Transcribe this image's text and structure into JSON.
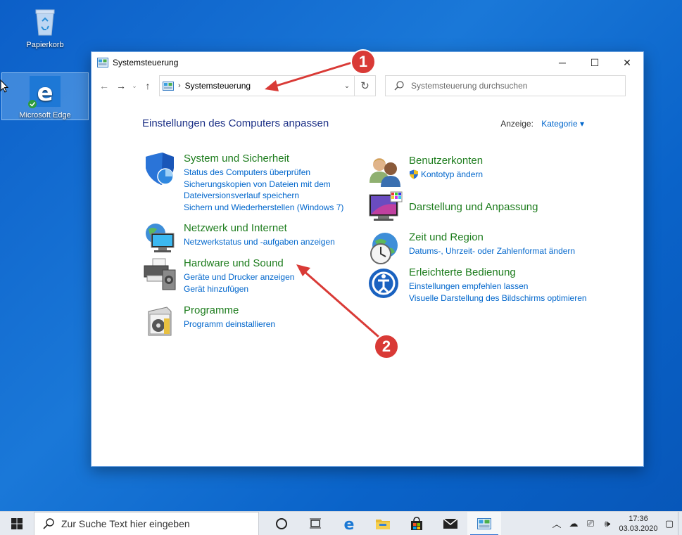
{
  "desktop": {
    "icons": [
      {
        "label": "Papierkorb",
        "icon": "recycle-bin-icon"
      },
      {
        "label": "Microsoft Edge",
        "icon": "edge-icon"
      }
    ]
  },
  "window": {
    "title": "Systemsteuerung",
    "address": "Systemsteuerung",
    "search_placeholder": "Systemsteuerung durchsuchen",
    "minimize": "─",
    "maximize": "☐",
    "close": "✕"
  },
  "content": {
    "heading": "Einstellungen des Computers anpassen",
    "view_label": "Anzeige:",
    "view_value": "Kategorie ▾",
    "left_categories": [
      {
        "title": "System und Sicherheit",
        "icon": "shield-icon",
        "links": [
          "Status des Computers überprüfen",
          "Sicherungskopien von Dateien mit dem Dateiversionsverlauf speichern",
          "Sichern und Wiederherstellen (Windows 7)"
        ]
      },
      {
        "title": "Netzwerk und Internet",
        "icon": "network-globe-icon",
        "links": [
          "Netzwerkstatus und -aufgaben anzeigen"
        ]
      },
      {
        "title": "Hardware und Sound",
        "icon": "printer-speaker-icon",
        "links": [
          "Geräte und Drucker anzeigen",
          "Gerät hinzufügen"
        ]
      },
      {
        "title": "Programme",
        "icon": "programs-icon",
        "links": [
          "Programm deinstallieren"
        ]
      }
    ],
    "right_categories": [
      {
        "title": "Benutzerkonten",
        "icon": "users-icon",
        "links": [
          "Kontotyp ändern"
        ]
      },
      {
        "title": "Darstellung und Anpassung",
        "icon": "display-color-icon",
        "links": []
      },
      {
        "title": "Zeit und Region",
        "icon": "clock-globe-icon",
        "links": [
          "Datums-, Uhrzeit- oder Zahlenformat ändern"
        ]
      },
      {
        "title": "Erleichterte Bedienung",
        "icon": "accessibility-icon",
        "links": [
          "Einstellungen empfehlen lassen",
          "Visuelle Darstellung des Bildschirms optimieren"
        ]
      }
    ]
  },
  "annotations": [
    {
      "label": "1"
    },
    {
      "label": "2"
    }
  ],
  "taskbar": {
    "search_placeholder": "Zur Suche Text hier eingeben",
    "time": "17:36",
    "date": "03.03.2020"
  },
  "colors": {
    "category_title": "#1e7d1e",
    "link": "#0066cc",
    "heading": "#1e3287",
    "annotation": "#d93a36"
  }
}
